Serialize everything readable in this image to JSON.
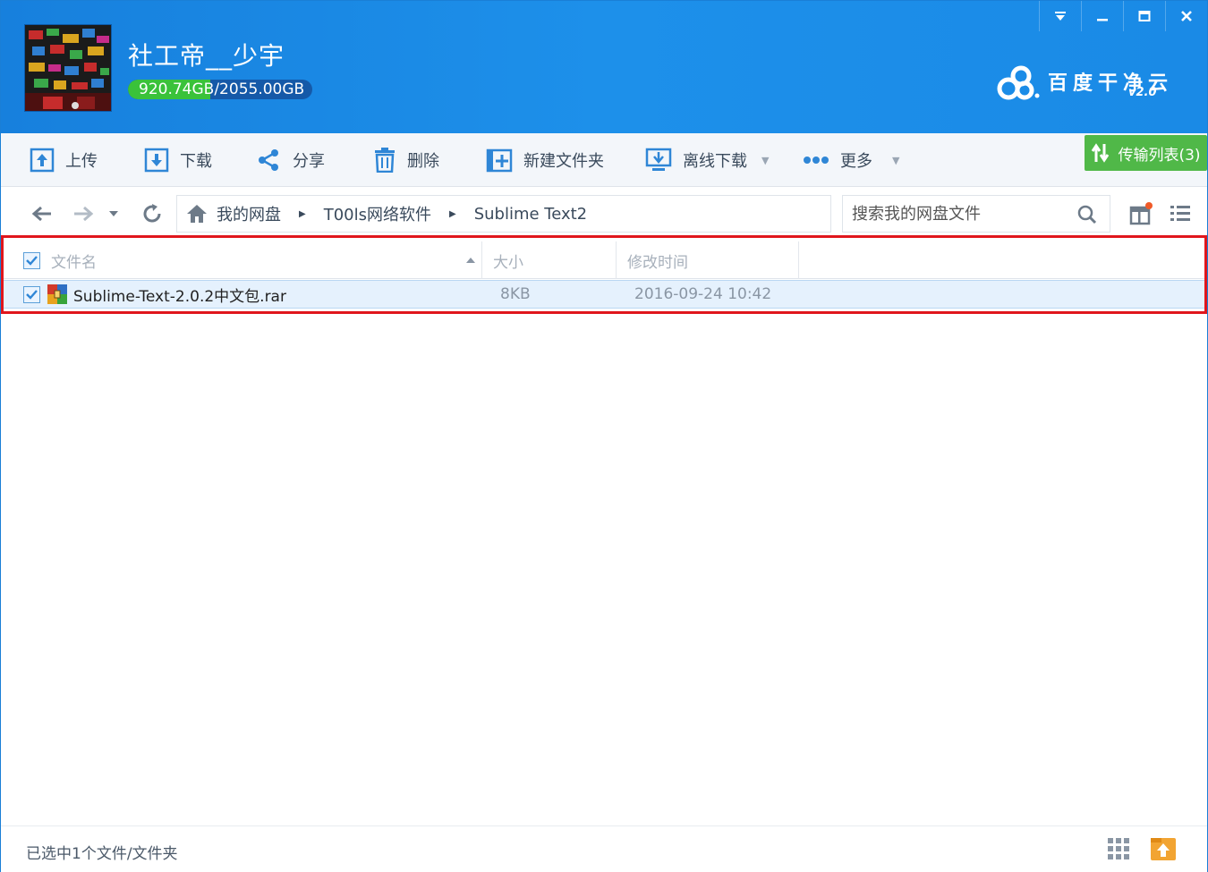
{
  "header": {
    "username": "社工帝__少宇",
    "quota_used": "920.74GB",
    "quota_total": "/2055.00GB",
    "quota_fraction": 0.448,
    "brand_name": "百度干净云",
    "brand_version": "v2.0"
  },
  "window_controls": {
    "menu_icon": "dropdown-menu-icon",
    "minimize_icon": "minimize-icon",
    "maximize_icon": "maximize-icon",
    "close_icon": "close-icon"
  },
  "toolbar": {
    "upload": "上传",
    "download": "下载",
    "share": "分享",
    "delete": "删除",
    "new_folder": "新建文件夹",
    "offline_download": "离线下载",
    "more": "更多",
    "transfer_list": "传输列表(3)"
  },
  "breadcrumb": {
    "items": [
      "我的网盘",
      "T00ls网络软件",
      "Sublime Text2"
    ]
  },
  "search": {
    "placeholder": "搜索我的网盘文件"
  },
  "table": {
    "headers": {
      "name": "文件名",
      "size": "大小",
      "modified": "修改时间"
    },
    "rows": [
      {
        "name": "Sublime-Text-2.0.2中文包.rar",
        "size": "8KB",
        "modified": "2016-09-24 10:42",
        "selected": true
      }
    ]
  },
  "status": {
    "text": "已选中1个文件/文件夹"
  },
  "colors": {
    "header_blue": "#1a8ae6",
    "quota_green": "#3ac23a",
    "transfer_green": "#50b848",
    "highlight_red": "#e0161c",
    "selected_row": "#e5f1fd"
  }
}
